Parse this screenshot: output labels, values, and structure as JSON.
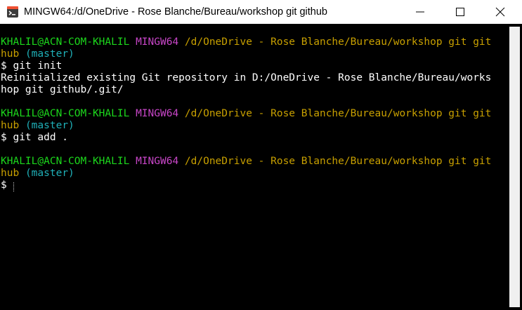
{
  "window": {
    "title": "MINGW64:/d/OneDrive - Rose Blanche/Bureau/workshop git github"
  },
  "colors": {
    "user": "#1cd81c",
    "mingw": "#c846c8",
    "path": "#c8a000",
    "branch": "#1fb0b8",
    "background": "#000000"
  },
  "icons": [
    "git-bash-icon",
    "minimize-icon",
    "maximize-icon",
    "close-icon"
  ],
  "terminal": {
    "prompt1": {
      "user": "KHALIL@ACN-COM-KHALIL",
      "system": "MINGW64",
      "path_a": "/d/OneDrive - Rose Blanche/Bureau/workshop git git",
      "path_b": "hub",
      "branch": "(master)"
    },
    "cmd1": "$ git init",
    "output1_a": "Reinitialized existing Git repository in D:/OneDrive - Rose Blanche/Bureau/works",
    "output1_b": "hop git github/.git/",
    "prompt2": {
      "user": "KHALIL@ACN-COM-KHALIL",
      "system": "MINGW64",
      "path_a": "/d/OneDrive - Rose Blanche/Bureau/workshop git git",
      "path_b": "hub",
      "branch": "(master)"
    },
    "cmd2": "$ git add .",
    "prompt3": {
      "user": "KHALIL@ACN-COM-KHALIL",
      "system": "MINGW64",
      "path_a": "/d/OneDrive - Rose Blanche/Bureau/workshop git git",
      "path_b": "hub",
      "branch": "(master)"
    },
    "cmd3": "$ "
  }
}
